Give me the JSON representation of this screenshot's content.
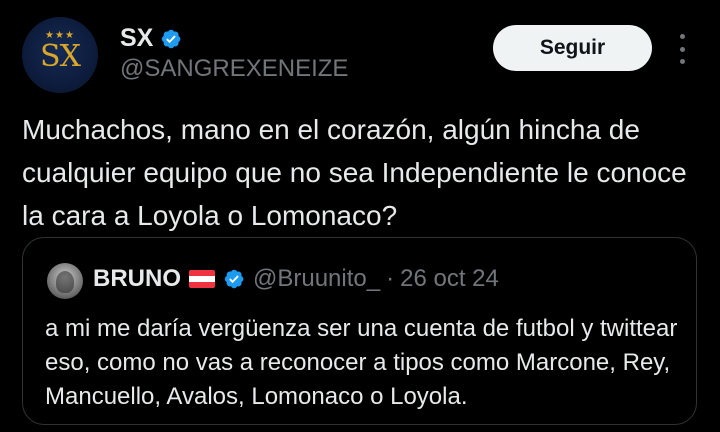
{
  "author": {
    "avatar_stars": "★★★",
    "avatar_monogram": "SX",
    "display_name": "SX",
    "handle": "@SANGREXENEIZE",
    "verified": true,
    "verified_color": "#1d9bf0"
  },
  "actions": {
    "follow_label": "Seguir",
    "more_icon": "more-vertical-icon"
  },
  "tweet": {
    "text": "Muchachos, mano en el corazón, algún hincha de cualquier equipo que no sea Independiente le conoce la cara a Loyola o Lomonaco?"
  },
  "quoted_tweet": {
    "display_name": "BRUNO",
    "flag_icon": "austria-flag-icon",
    "verified": true,
    "handle": "@Bruunito_",
    "separator": "·",
    "date": "26 oct 24",
    "text": "a mi me daría vergüenza ser una cuenta de futbol y twittear eso, como no vas a reconocer a tipos como Marcone, Rey, Mancuello, Avalos, Lomonaco o Loyola."
  },
  "colors": {
    "background": "#000000",
    "text_primary": "#e7e9ea",
    "text_secondary": "#71767b",
    "border": "#2f3336",
    "button_bg": "#eff3f4",
    "avatar_gold": "#d9a72a",
    "avatar_navy": "#0c1a38"
  }
}
